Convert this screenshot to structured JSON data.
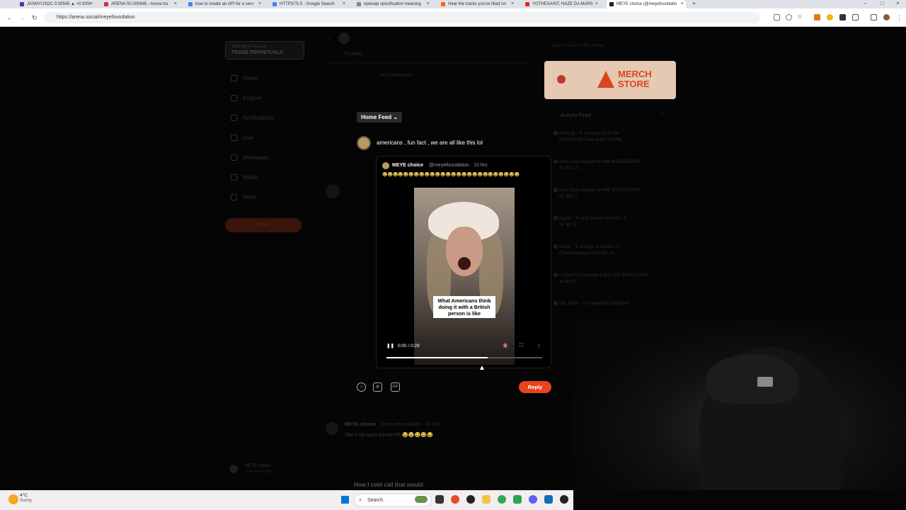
{
  "browser": {
    "tabs": [
      {
        "title": "JASMYUSDC 0.00545 ▲ +0.93%",
        "color": "#5a2ea6"
      },
      {
        "title": "ARENA 50.000845 - Arena tra",
        "color": "#c33"
      },
      {
        "title": "how to create an API for a serv",
        "color": "#4285f4"
      },
      {
        "title": "HTTPS/TLS - Google Search",
        "color": "#4285f4"
      },
      {
        "title": "openapi specification meaning",
        "color": "#888"
      },
      {
        "title": "Hear the tracks you've liked on",
        "color": "#f60"
      },
      {
        "title": "YOTHESAINT, HAZE DA MARS",
        "color": "#e22"
      },
      {
        "title": "MEYE choice (@meyefoundatio",
        "color": "#222"
      }
    ],
    "url": "https://arena.social/meyefoundation"
  },
  "sidebar": {
    "promo_small": "Trade More. Pay Less.",
    "promo": "TRADE PERPETUALS",
    "items": [
      "Home",
      "Explore",
      "Notifications",
      "Live",
      "Messages",
      "Wallet",
      "More"
    ],
    "post_label": "Post",
    "user_name": "MEYE choice",
    "user_handle": "@meyefoundation"
  },
  "header": {
    "threads": "Threads",
    "banner_text": "BEATHEMAKES"
  },
  "composer": {
    "feed_selector": "Home Feed",
    "text": "americans , fun fact , we are all like this lol",
    "reply_label": "Reply",
    "gif_label": "GIF"
  },
  "quoted_post": {
    "author": "MEYE choice",
    "handle": "@meyefoundation",
    "time": "15 hrs",
    "emojis": "😂😂😂😂😂😂😂😂😂😂😂😂😂😂😂😂😂😂😂😂😂😂😂😂😂😂",
    "video_caption": "What Americans think doing it with a British person is like",
    "time_display": "0:00 / 0:29",
    "progress": 0.65
  },
  "below_post": {
    "author": "MEYE choice",
    "handle": "@meyefoundation · 16 hrs",
    "text": "She's my spirit animal FR 😂😂😂😂😂",
    "preview": "How I cold call that would"
  },
  "right": {
    "search_placeholder": "Search Users in The Arena",
    "merch_line1": "MERCH",
    "merch_line2": "STORE",
    "activity_title": "Activity Feed",
    "feed": [
      {
        "l1": "RenLop · ✎ Listed a $158.36",
        "l2": "BTC/SHORT with a $1.7K PNL"
      },
      {
        "l1": "Keel Taren bought 5.64M $REDEEMER",
        "l2": "for $12.71"
      },
      {
        "l1": "Keel Taren bought 8.66M $REDEEMER",
        "l2": "for $47.7"
      },
      {
        "l1": "David · ✎ sent Tickets of klaris ♙",
        "l2": "for $0.11"
      },
      {
        "l1": "David · ✎ bought 1.16 kids of",
        "l2": "Cheetahgang.eth for $2.12"
      },
      {
        "l1": "CryptoTurk opened a $18.15K AVAX/LONG",
        "l2": "at $8.04"
      },
      {
        "l1": "CR..MAX · ✎ staked 800 $ARENA",
        "l2": ""
      }
    ]
  },
  "taskbar": {
    "weather_temp": "4°C",
    "weather_desc": "Sunny",
    "search_label": "Search"
  }
}
